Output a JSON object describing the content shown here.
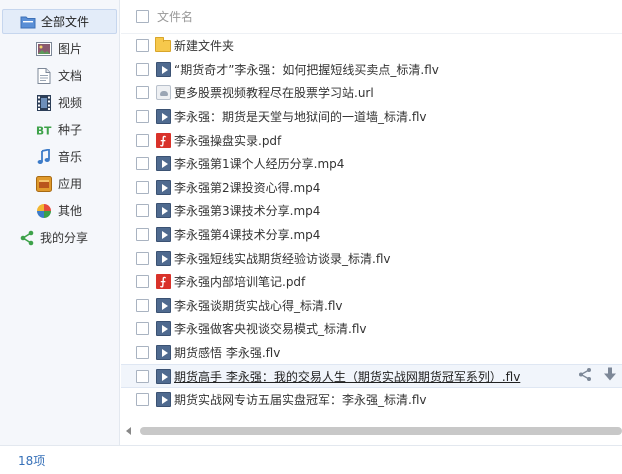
{
  "sidebar": {
    "items": [
      {
        "label": "全部文件",
        "icon": "folder-icon",
        "active": true,
        "top": true
      },
      {
        "label": "图片",
        "icon": "image-icon"
      },
      {
        "label": "文档",
        "icon": "document-icon"
      },
      {
        "label": "视频",
        "icon": "film-icon"
      },
      {
        "label": "种子",
        "icon": "bt-icon"
      },
      {
        "label": "音乐",
        "icon": "music-note-icon"
      },
      {
        "label": "应用",
        "icon": "app-icon"
      },
      {
        "label": "其他",
        "icon": "pie-icon"
      },
      {
        "label": "我的分享",
        "icon": "share-icon",
        "top": true
      }
    ]
  },
  "list": {
    "header": "文件名",
    "files": [
      {
        "name": "新建文件夹",
        "type": "folder"
      },
      {
        "name": "“期货奇才”李永强：如何把握短线买卖点_标清.flv",
        "type": "video"
      },
      {
        "name": "更多股票视频教程尽在股票学习站.url",
        "type": "url"
      },
      {
        "name": "李永强：期货是天堂与地狱间的一道墙_标清.flv",
        "type": "video"
      },
      {
        "name": "李永强操盘实录.pdf",
        "type": "pdf"
      },
      {
        "name": "李永强第1课个人经历分享.mp4",
        "type": "video"
      },
      {
        "name": "李永强第2课投资心得.mp4",
        "type": "video"
      },
      {
        "name": "李永强第3课技术分享.mp4",
        "type": "video"
      },
      {
        "name": "李永强第4课技术分享.mp4",
        "type": "video"
      },
      {
        "name": "李永强短线实战期货经验访谈录_标清.flv",
        "type": "video"
      },
      {
        "name": "李永强内部培训笔记.pdf",
        "type": "pdf"
      },
      {
        "name": "李永强谈期货实战心得_标清.flv",
        "type": "video"
      },
      {
        "name": "李永强做客央视谈交易模式_标清.flv",
        "type": "video"
      },
      {
        "name": "期货感悟 李永强.flv",
        "type": "video"
      },
      {
        "name": "期货高手 李永强：我的交易人生（期货实战网期货冠军系列）.flv",
        "type": "video",
        "hover": true
      },
      {
        "name": "期货实战网专访五届实盘冠军：李永强_标清.flv",
        "type": "video"
      }
    ]
  },
  "footer": {
    "count": "18项"
  },
  "colors": {
    "accent": "#3670b8",
    "sidebar_bg": "#f5f7fb",
    "active_bg": "#e3ecf9"
  }
}
